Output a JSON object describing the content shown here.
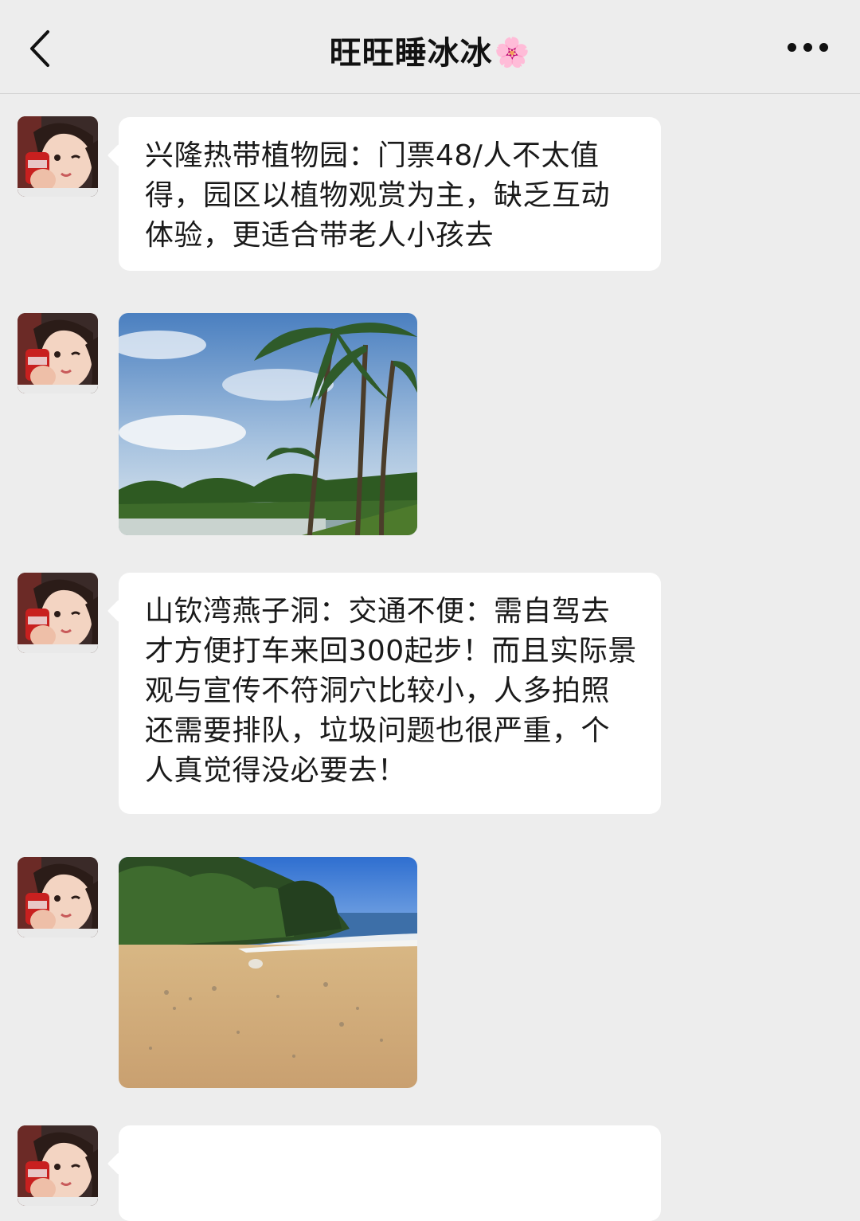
{
  "header": {
    "title": "旺旺睡冰冰",
    "title_emoji": "🌸",
    "back_icon": "chevron-left-icon",
    "more_icon": "more-dots-icon"
  },
  "messages": [
    {
      "type": "text",
      "sender": "旺旺睡冰冰",
      "text": "兴隆热带植物园：门票48/人不太值得，园区以植物观赏为主，缺乏互动体验，更适合带老人小孩去"
    },
    {
      "type": "image",
      "sender": "旺旺睡冰冰",
      "content": "palm-tree-lake-photo"
    },
    {
      "type": "text",
      "sender": "旺旺睡冰冰",
      "text": "山钦湾燕子洞：交通不便：需自驾去才方便打车来回300起步！而且实际景观与宣传不符洞穴比较小，人多拍照还需要排队，垃圾问题也很严重，个人真觉得没必要去！"
    },
    {
      "type": "image",
      "sender": "旺旺睡冰冰",
      "content": "sandy-beach-photo"
    },
    {
      "type": "text",
      "sender": "旺旺睡冰冰",
      "text": ""
    }
  ],
  "colors": {
    "background": "#ededed",
    "bubble": "#ffffff",
    "text": "#1a1a1a"
  }
}
